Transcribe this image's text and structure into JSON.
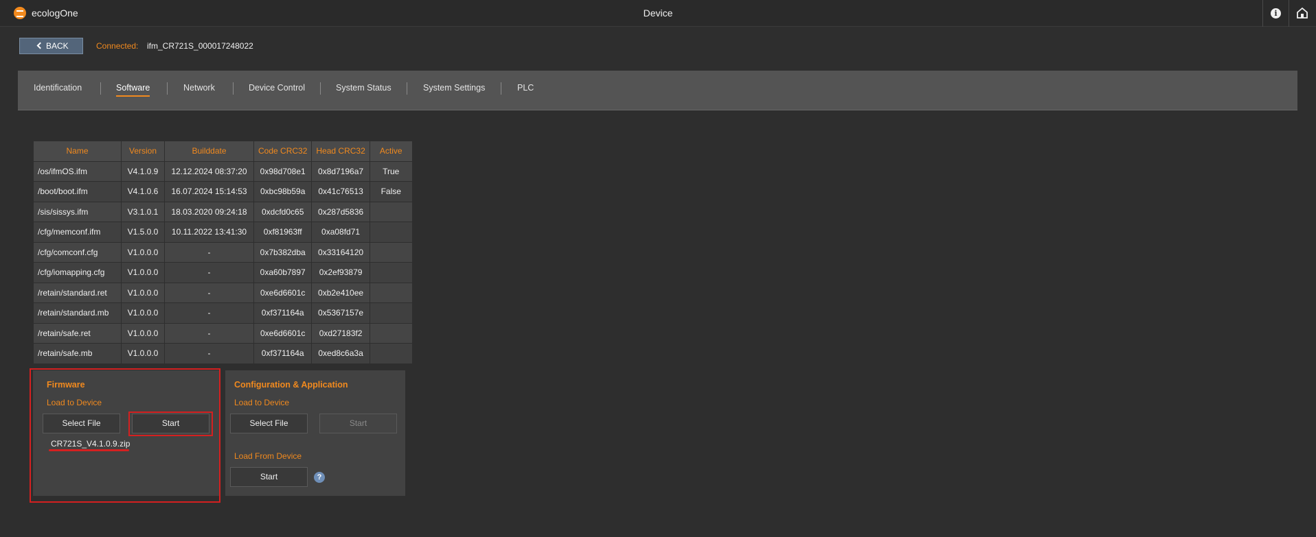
{
  "titlebar": {
    "app_name": "ecologOne",
    "window_title": "Device",
    "icons": {
      "info": "info-icon",
      "home": "home-icon",
      "logo": "ecolog-logo-icon"
    }
  },
  "header": {
    "back_label": "BACK",
    "connected_label": "Connected:",
    "connected_device": "ifm_CR721S_000017248022"
  },
  "tabs": [
    {
      "label": "Identification",
      "active": false
    },
    {
      "label": "Software",
      "active": true
    },
    {
      "label": "Network",
      "active": false
    },
    {
      "label": "Device Control",
      "active": false
    },
    {
      "label": "System Status",
      "active": false
    },
    {
      "label": "System Settings",
      "active": false
    },
    {
      "label": "PLC",
      "active": false
    }
  ],
  "software_table": {
    "columns": [
      "Name",
      "Version",
      "Builddate",
      "Code CRC32",
      "Head CRC32",
      "Active"
    ],
    "rows": [
      [
        "/os/ifmOS.ifm",
        "V4.1.0.9",
        "12.12.2024 08:37:20",
        "0x98d708e1",
        "0x8d7196a7",
        "True"
      ],
      [
        "/boot/boot.ifm",
        "V4.1.0.6",
        "16.07.2024 15:14:53",
        "0xbc98b59a",
        "0x41c76513",
        "False"
      ],
      [
        "/sis/sissys.ifm",
        "V3.1.0.1",
        "18.03.2020 09:24:18",
        "0xdcfd0c65",
        "0x287d5836",
        ""
      ],
      [
        "/cfg/memconf.ifm",
        "V1.5.0.0",
        "10.11.2022 13:41:30",
        "0xf81963ff",
        "0xa08fd71",
        ""
      ],
      [
        "/cfg/comconf.cfg",
        "V1.0.0.0",
        "-",
        "0x7b382dba",
        "0x33164120",
        ""
      ],
      [
        "/cfg/iomapping.cfg",
        "V1.0.0.0",
        "-",
        "0xa60b7897",
        "0x2ef93879",
        ""
      ],
      [
        "/retain/standard.ret",
        "V1.0.0.0",
        "-",
        "0xe6d6601c",
        "0xb2e410ee",
        ""
      ],
      [
        "/retain/standard.mb",
        "V1.0.0.0",
        "-",
        "0xf371164a",
        "0x5367157e",
        ""
      ],
      [
        "/retain/safe.ret",
        "V1.0.0.0",
        "-",
        "0xe6d6601c",
        "0xd27183f2",
        ""
      ],
      [
        "/retain/safe.mb",
        "V1.0.0.0",
        "-",
        "0xf371164a",
        "0xed8c6a3a",
        ""
      ]
    ]
  },
  "firmware": {
    "title": "Firmware",
    "load_to_device": "Load to Device",
    "select_file": "Select File",
    "start": "Start",
    "file_name": "CR721S_V4.1.0.9.zip"
  },
  "config": {
    "title": "Configuration & Application",
    "load_to_device": "Load to Device",
    "select_file": "Select File",
    "start_disabled": "Start",
    "load_from_device": "Load From Device",
    "start": "Start",
    "help": "?"
  },
  "colors": {
    "accent": "#f28a1e",
    "highlight": "#d52020",
    "back_button": "#53657a"
  }
}
